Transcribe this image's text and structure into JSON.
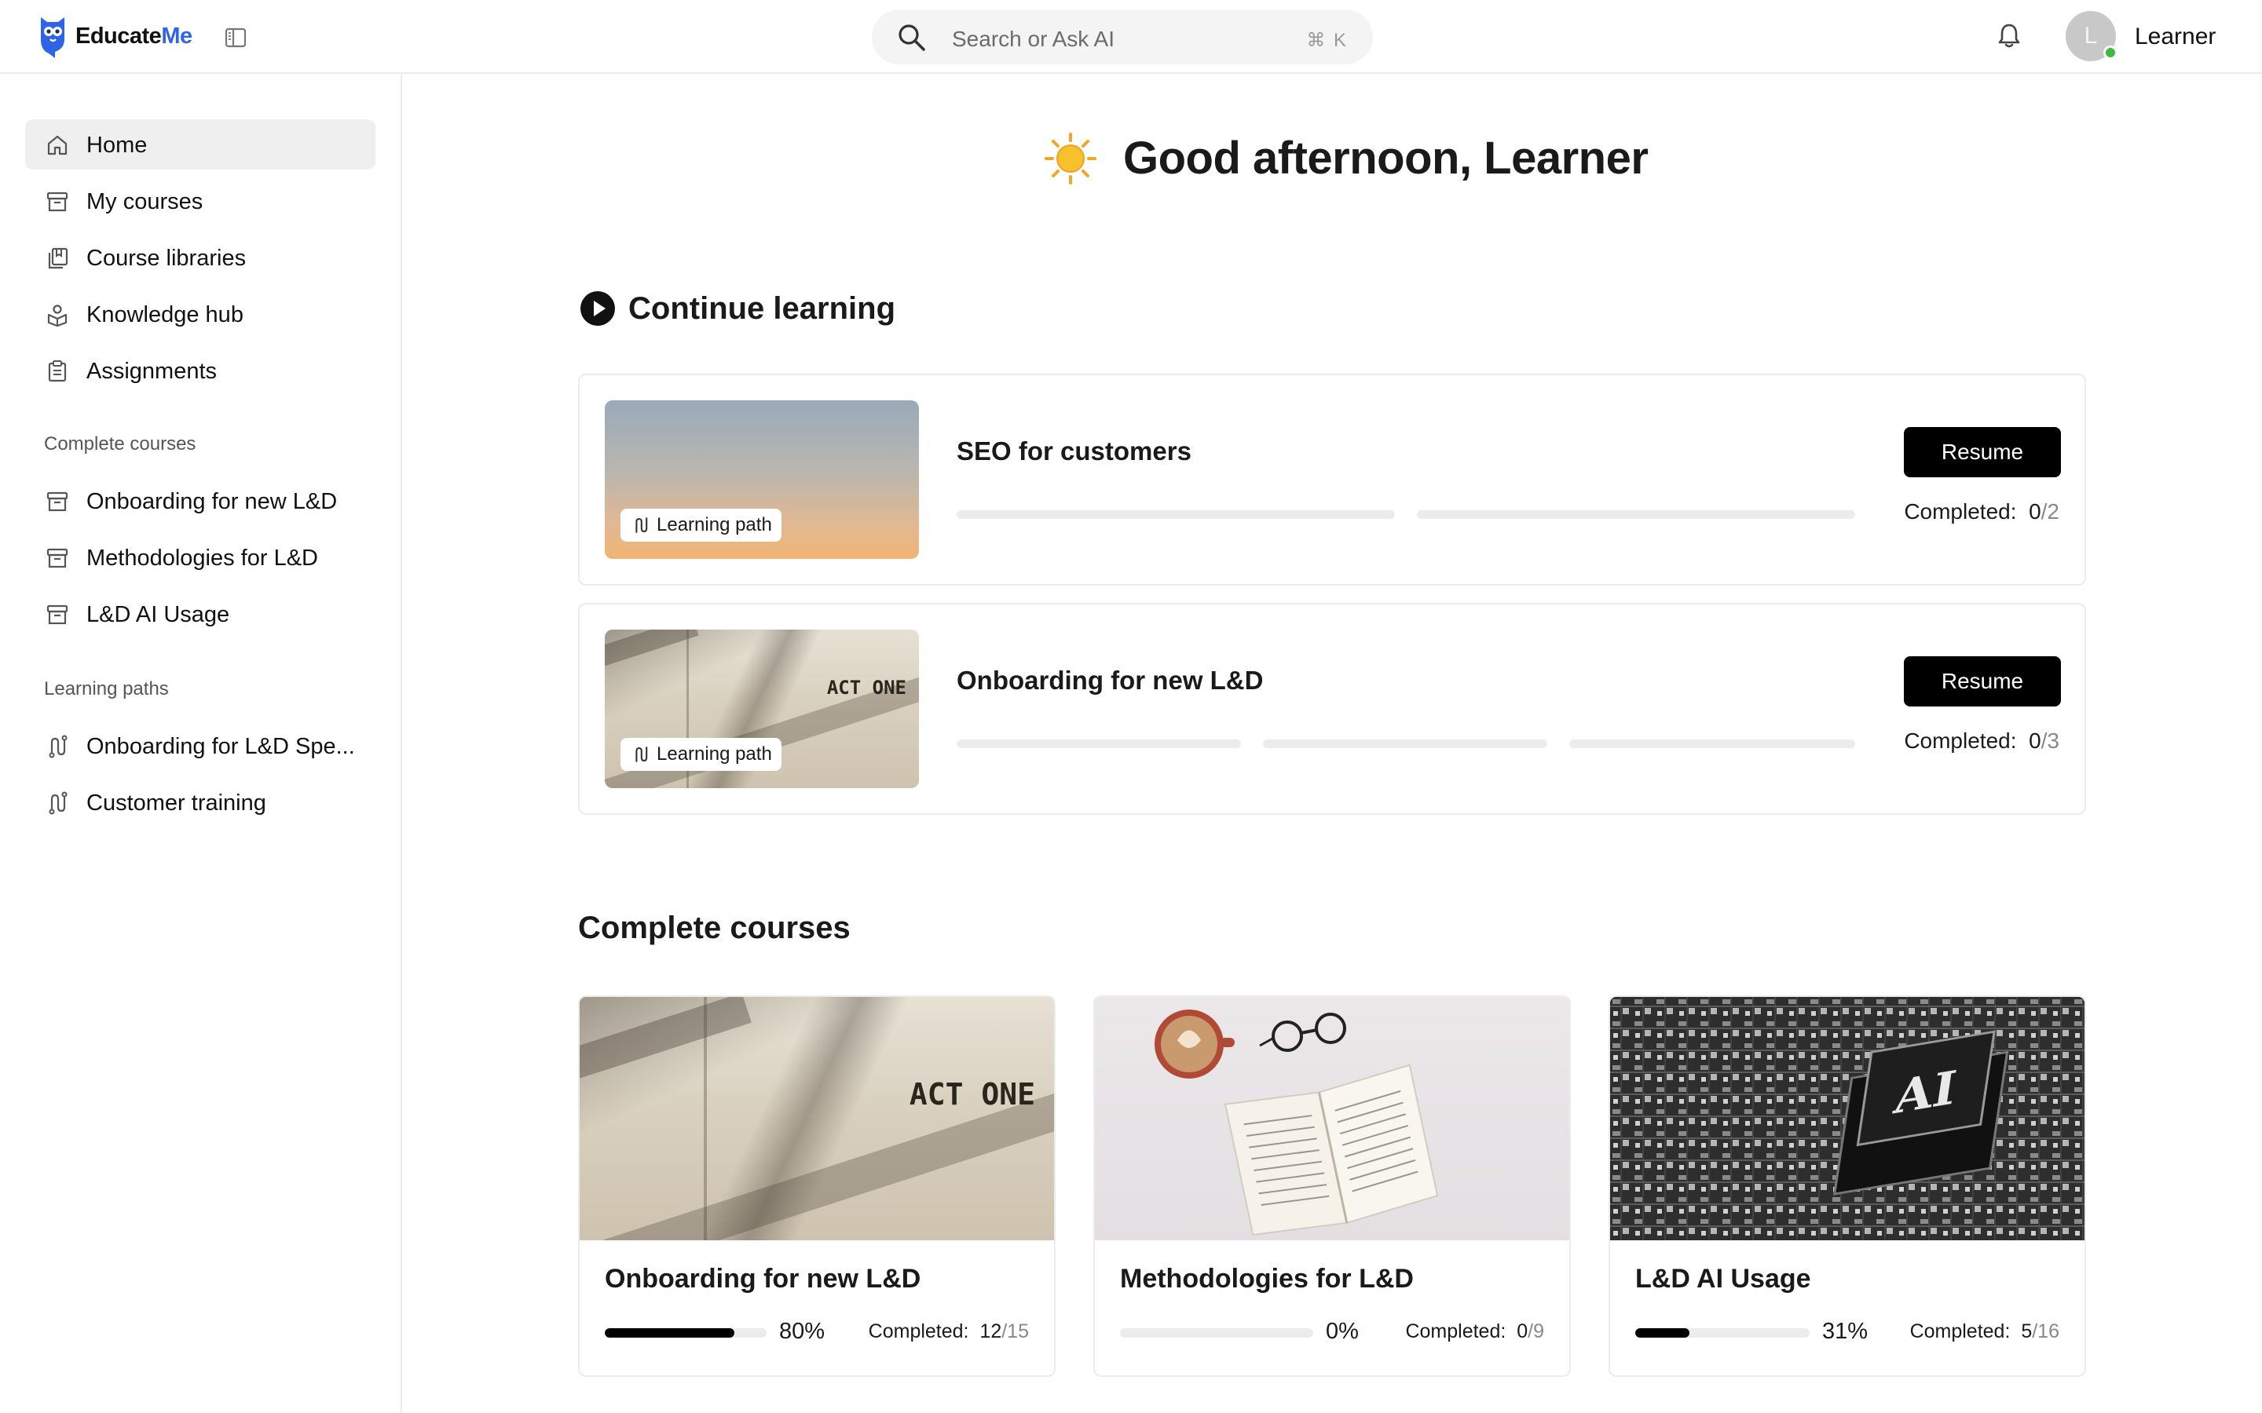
{
  "header": {
    "logo_text_main": "Educate",
    "logo_text_accent": "Me",
    "search_placeholder": "Search or Ask AI",
    "search_shortcut": "⌘ K",
    "avatar_initial": "L",
    "user_name": "Learner"
  },
  "sidebar": {
    "items": [
      {
        "label": "Home",
        "icon": "home-icon",
        "active": true
      },
      {
        "label": "My courses",
        "icon": "archive-icon"
      },
      {
        "label": "Course libraries",
        "icon": "library-icon"
      },
      {
        "label": "Knowledge hub",
        "icon": "knowledge-icon"
      },
      {
        "label": "Assignments",
        "icon": "clipboard-icon"
      }
    ],
    "complete_courses_title": "Complete courses",
    "complete_courses": [
      {
        "label": "Onboarding for new L&D",
        "icon": "archive-icon"
      },
      {
        "label": "Methodologies for L&D",
        "icon": "archive-icon"
      },
      {
        "label": "L&D AI Usage",
        "icon": "archive-icon"
      }
    ],
    "learning_paths_title": "Learning paths",
    "learning_paths": [
      {
        "label": "Onboarding for L&D Spe...",
        "icon": "path-icon"
      },
      {
        "label": "Customer training",
        "icon": "path-icon"
      }
    ]
  },
  "greeting": {
    "icon": "sun-icon",
    "text": "Good afternoon, Learner"
  },
  "continue_learning": {
    "title": "Continue learning",
    "items": [
      {
        "name": "SEO for customers",
        "badge": "Learning path",
        "button": "Resume",
        "completed_label": "Completed:",
        "completed_done": "0",
        "completed_total": "/2",
        "progress_fraction": 0
      },
      {
        "name": "Onboarding for new L&D",
        "badge": "Learning path",
        "button": "Resume",
        "completed_label": "Completed:",
        "completed_done": "0",
        "completed_total": "/3",
        "progress_fraction": 0,
        "thumb_text": "ACT ONE"
      }
    ]
  },
  "complete_courses": {
    "title": "Complete courses",
    "items": [
      {
        "name": "Onboarding for new L&D",
        "percent": "80%",
        "progress_fraction": 0.8,
        "completed_label": "Completed:",
        "completed_done": "12",
        "completed_total": "/15",
        "image_text": "ACT ONE"
      },
      {
        "name": "Methodologies for L&D",
        "percent": "0%",
        "progress_fraction": 0,
        "completed_label": "Completed:",
        "completed_done": "0",
        "completed_total": "/9"
      },
      {
        "name": "L&D AI Usage",
        "percent": "31%",
        "progress_fraction": 0.31,
        "completed_label": "Completed:",
        "completed_done": "5",
        "completed_total": "/16",
        "image_text": "AI"
      }
    ]
  }
}
